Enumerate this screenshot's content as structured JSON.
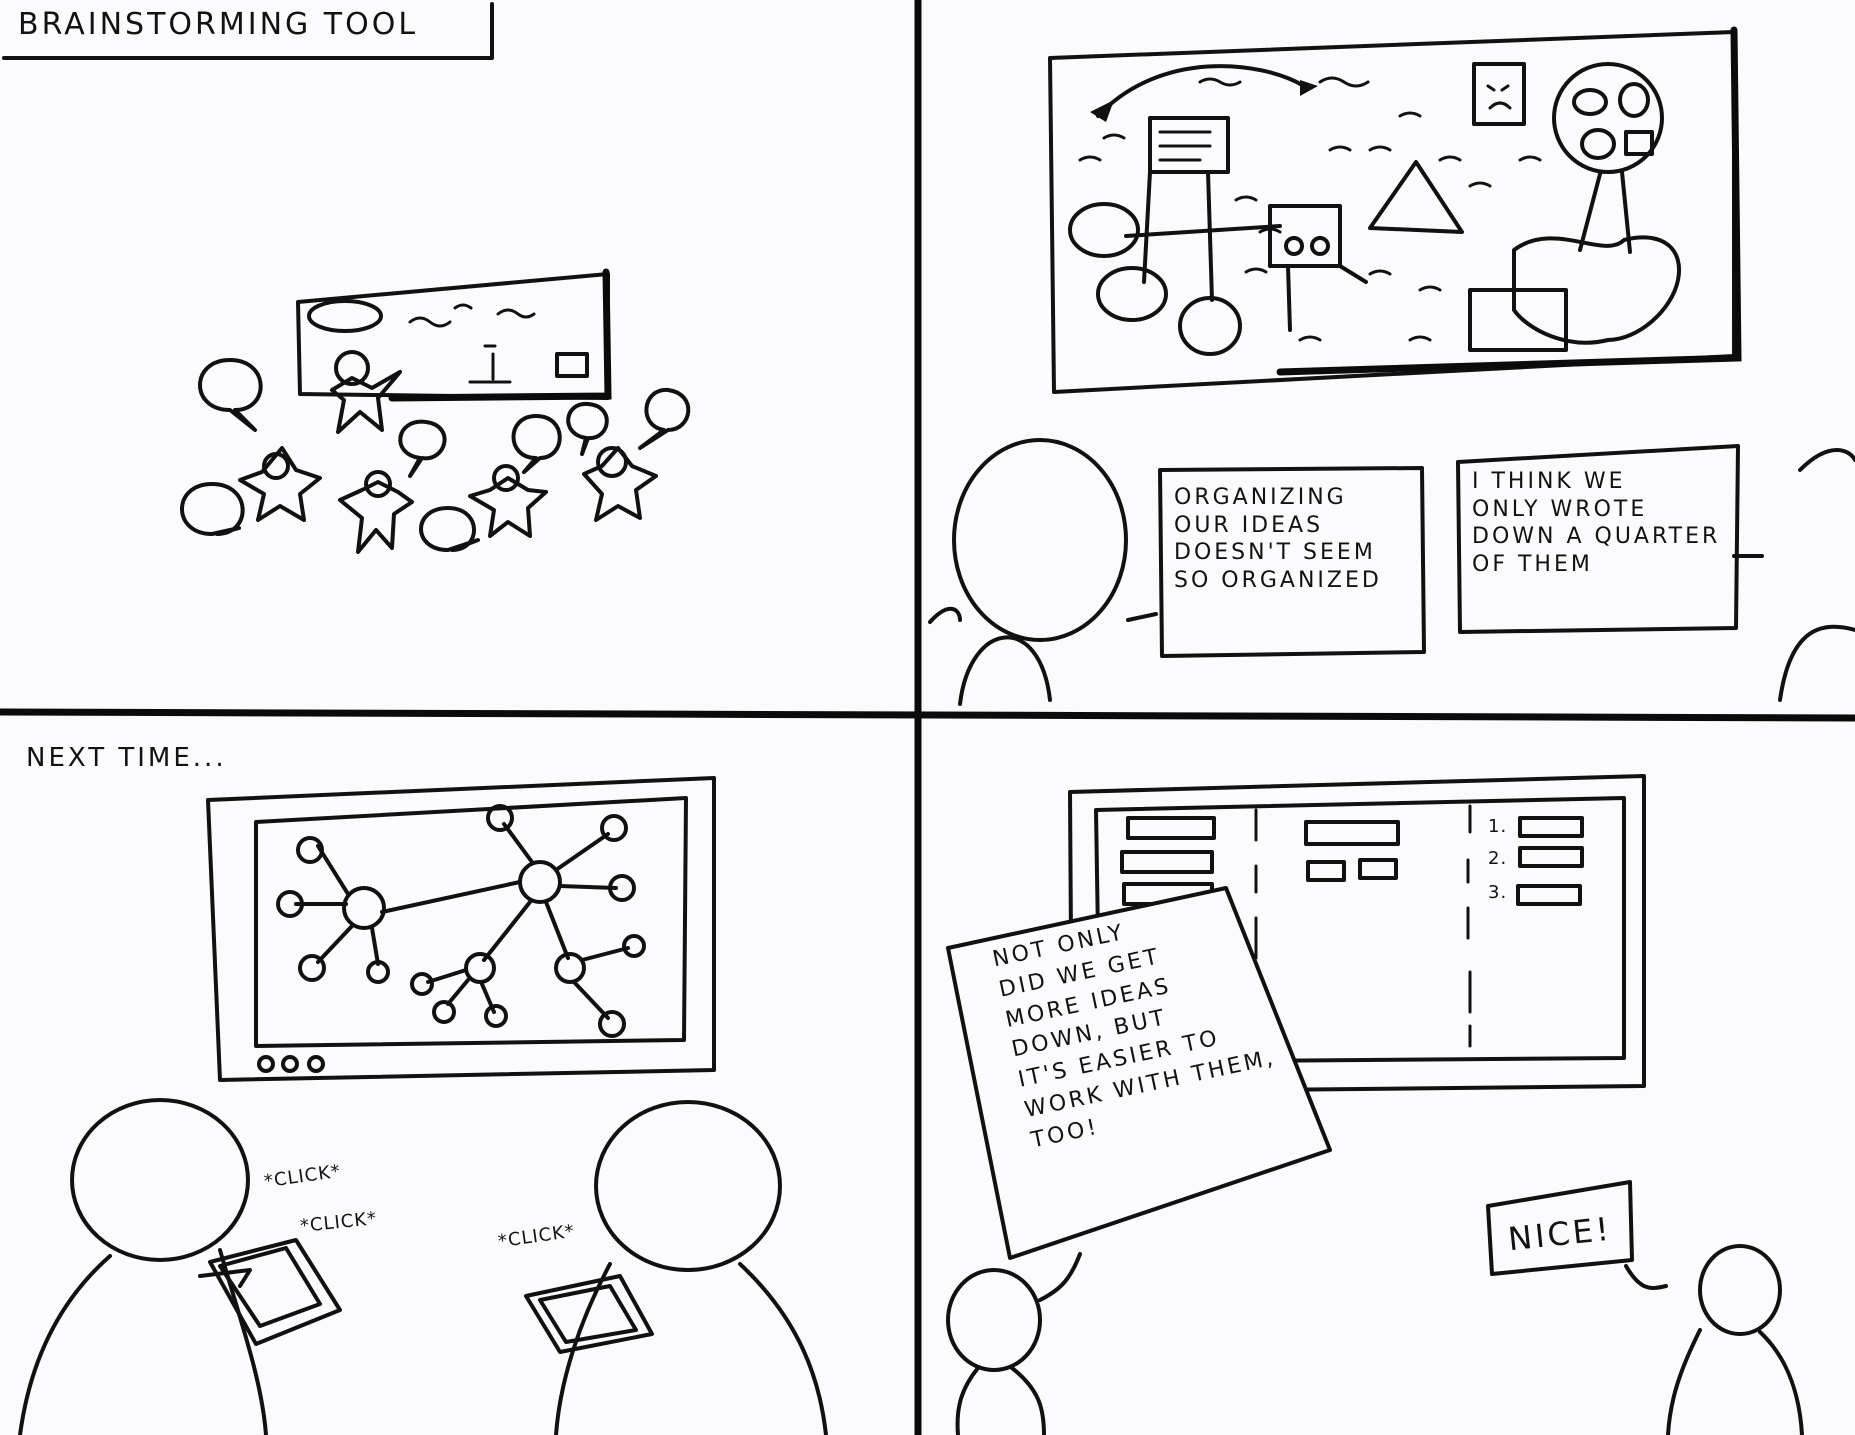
{
  "title": "BRAINSTORMING TOOL",
  "panel2": {
    "bubble_left": [
      "ORGANIZING",
      "OUR IDEAS",
      "DOESN'T SEEM",
      "SO ORGANIZED"
    ],
    "bubble_right": [
      "I THINK WE",
      "ONLY WROTE",
      "DOWN A QUARTER",
      "OF THEM"
    ]
  },
  "panel3": {
    "caption": "NEXT TIME...",
    "click_1": "*CLICK*",
    "click_2": "*CLICK*",
    "click_3": "*CLICK*"
  },
  "panel4": {
    "list_numbers": [
      "1.",
      "2.",
      "3."
    ],
    "bubble_lines": [
      "NOT ONLY",
      "DID WE GET",
      "MORE IDEAS",
      "DOWN, BUT",
      "IT'S EASIER TO",
      "WORK WITH THEM,",
      "TOO!"
    ],
    "reply": "NICE!"
  },
  "colors": {
    "paper": "#fbfafc",
    "ink": "#111111",
    "background": "#d2c9b9"
  }
}
